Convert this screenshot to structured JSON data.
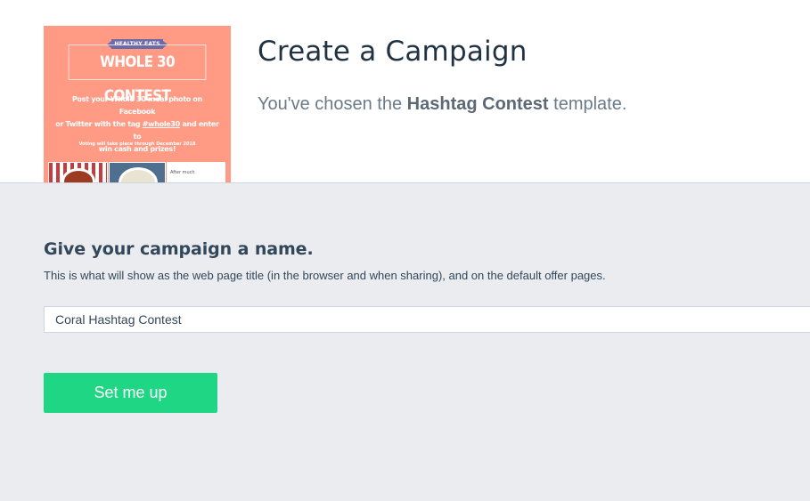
{
  "header": {
    "title": "Create a Campaign",
    "subtitle_prefix": "You've chosen the",
    "template_name": "Hashtag Contest",
    "subtitle_suffix": "template."
  },
  "template_preview": {
    "ribbon_text": "HEALTHY EATS",
    "title": "WHOLE 30 CONTEST",
    "body_line1": "Post your Whole 30 meal photo on Facebook",
    "body_line2_prefix": "or Twitter with the tag",
    "body_hashtag": "#whole30",
    "body_line2_suffix": "and enter to",
    "body_line3": "win cash and prizes!",
    "small_print": "Voting will take place through December 2018",
    "photo3_text": "After much",
    "background_color": "#ff9a85"
  },
  "form": {
    "heading": "Give your campaign a name.",
    "help_text": "This is what will show as the web page title (in the browser and when sharing), and on the default offer pages.",
    "campaign_name_value": "Coral Hashtag Contest",
    "submit_label": "Set me up",
    "submit_color": "#1ed684"
  }
}
